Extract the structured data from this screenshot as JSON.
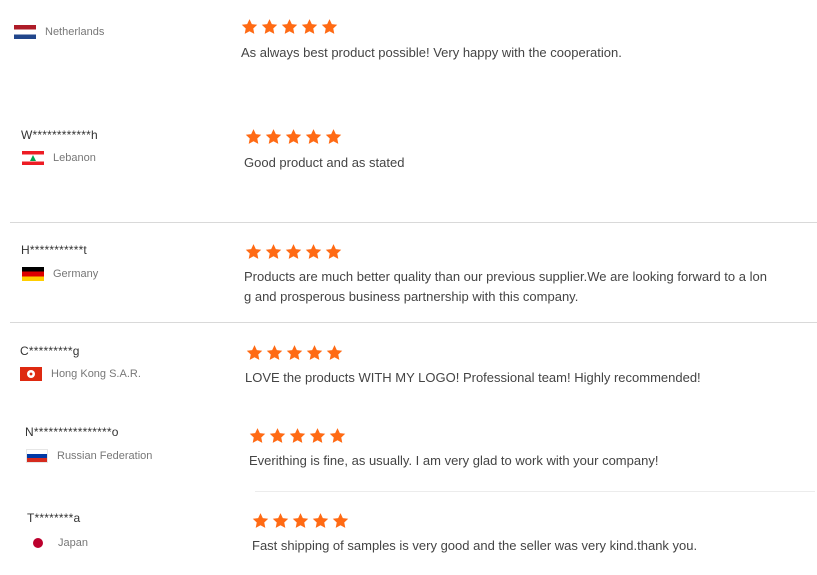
{
  "colors": {
    "star": "#ff6a14",
    "divider": "#d9d9d9",
    "text": "#444444",
    "country_text": "#777777"
  },
  "reviews": [
    {
      "reviewer": "",
      "country": "Netherlands",
      "flag_icon": "netherlands-flag-icon",
      "rating": 5,
      "comment_lines": [
        "As always best product possible! Very happy with the cooperation."
      ]
    },
    {
      "reviewer": "W************h",
      "country": "Lebanon",
      "flag_icon": "lebanon-flag-icon",
      "rating": 5,
      "comment_lines": [
        "Good product and as stated"
      ]
    },
    {
      "reviewer": "H***********t",
      "country": "Germany",
      "flag_icon": "germany-flag-icon",
      "rating": 5,
      "comment_lines": [
        "Products are much better quality than our previous supplier.We are looking forward to a lon",
        "g and prosperous business partnership with this company."
      ]
    },
    {
      "reviewer": "C*********g",
      "country": "Hong Kong S.A.R.",
      "flag_icon": "hong-kong-flag-icon",
      "rating": 5,
      "comment_lines": [
        "LOVE the products WITH MY LOGO! Professional team! Highly recommended!"
      ]
    },
    {
      "reviewer": "N****************o",
      "country": "Russian Federation",
      "flag_icon": "russia-flag-icon",
      "rating": 5,
      "comment_lines": [
        "Everithing is fine, as usually. I am very glad to work with your company!"
      ]
    },
    {
      "reviewer": "T********a",
      "country": "Japan",
      "flag_icon": "japan-flag-icon",
      "rating": 5,
      "comment_lines": [
        "Fast shipping of samples is very good and the seller was very kind.thank you."
      ]
    }
  ]
}
